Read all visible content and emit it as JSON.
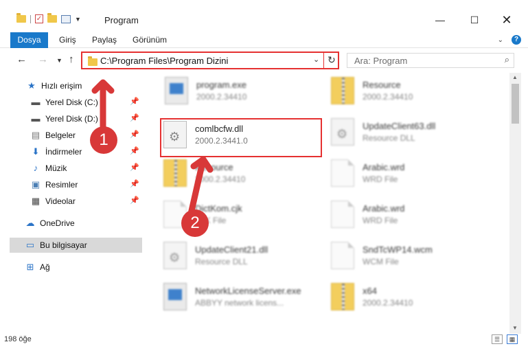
{
  "window": {
    "title": "Program",
    "minimize_glyph": "—",
    "maximize_glyph": "☐",
    "close_glyph": "✕"
  },
  "ribbon": {
    "tabs": [
      "Dosya",
      "Giriş",
      "Paylaş",
      "Görünüm"
    ]
  },
  "address_bar": {
    "path": "C:\\Program Files\\Program Dizini"
  },
  "search": {
    "placeholder": "Ara: Program"
  },
  "sidebar": {
    "items": [
      {
        "label": "Hızlı erişim",
        "icon": "star-icon"
      },
      {
        "label": "Yerel Disk (C:)",
        "icon": "drive-icon"
      },
      {
        "label": "Yerel Disk (D:)",
        "icon": "drive-icon"
      },
      {
        "label": "Belgeler",
        "icon": "documents-icon"
      },
      {
        "label": "İndirmeler",
        "icon": "downloads-icon"
      },
      {
        "label": "Müzik",
        "icon": "music-icon"
      },
      {
        "label": "Resimler",
        "icon": "pictures-icon"
      },
      {
        "label": "Videolar",
        "icon": "videos-icon"
      },
      {
        "label": "OneDrive",
        "icon": "cloud-icon"
      },
      {
        "label": "Bu bilgisayar",
        "icon": "computer-icon"
      },
      {
        "label": "Ağ",
        "icon": "network-icon"
      }
    ]
  },
  "files": [
    {
      "name": "program.exe",
      "meta": "2000.2.34410"
    },
    {
      "name": "Resource",
      "meta": "2000.2.34410"
    },
    {
      "name": "comlbcfw.dll",
      "meta": "2000.2.3441.0"
    },
    {
      "name": "UpdateClient63.dll",
      "meta": "Resource DLL"
    },
    {
      "name": "Resource",
      "meta": "2000.2.34410"
    },
    {
      "name": "Arabic.wrd",
      "meta": "WRD File"
    },
    {
      "name": "DictKom.cjk",
      "meta": "CJK File"
    },
    {
      "name": "Arabic.wrd",
      "meta": "WRD File"
    },
    {
      "name": "UpdateClient21.dll",
      "meta": "Resource DLL"
    },
    {
      "name": "SndTcWP14.wcm",
      "meta": "WCM File"
    },
    {
      "name": "NetworkLicenseServer.exe",
      "meta": "ABBYY network licens..."
    },
    {
      "name": "x64",
      "meta": "2000.2.34410"
    }
  ],
  "status": {
    "item_count": "198 öğe"
  },
  "annotations": {
    "badge1": "1",
    "badge2": "2"
  }
}
